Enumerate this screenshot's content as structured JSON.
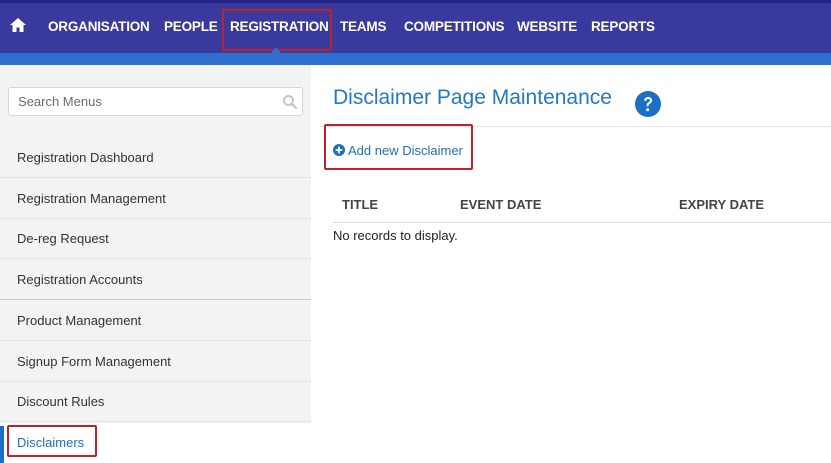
{
  "nav": {
    "items": [
      {
        "label": "ORGANISATION"
      },
      {
        "label": "PEOPLE"
      },
      {
        "label": "REGISTRATION"
      },
      {
        "label": "TEAMS"
      },
      {
        "label": "COMPETITIONS"
      },
      {
        "label": "WEBSITE"
      },
      {
        "label": "REPORTS"
      }
    ],
    "active": "REGISTRATION",
    "icon": "home-icon"
  },
  "sidebar": {
    "search": {
      "placeholder": "Search Menus",
      "value": ""
    },
    "items": [
      {
        "label": "Registration Dashboard"
      },
      {
        "label": "Registration Management"
      },
      {
        "label": "De-reg Request"
      },
      {
        "label": "Registration Accounts"
      },
      {
        "label": "Product Management"
      },
      {
        "label": "Signup Form Management"
      },
      {
        "label": "Discount Rules"
      },
      {
        "label": "Disclaimers"
      }
    ],
    "active": "Disclaimers"
  },
  "main": {
    "title": "Disclaimer Page Maintenance",
    "add_label": "Add new Disclaimer",
    "columns": [
      "TITLE",
      "EVENT DATE",
      "EXPIRY DATE"
    ],
    "empty_text": "No records to display."
  },
  "colors": {
    "nav_bg": "#3a3a9e",
    "nav_stripe": "#2f6fd0",
    "accent": "#1c6fc2",
    "highlight": "#c0222a"
  }
}
